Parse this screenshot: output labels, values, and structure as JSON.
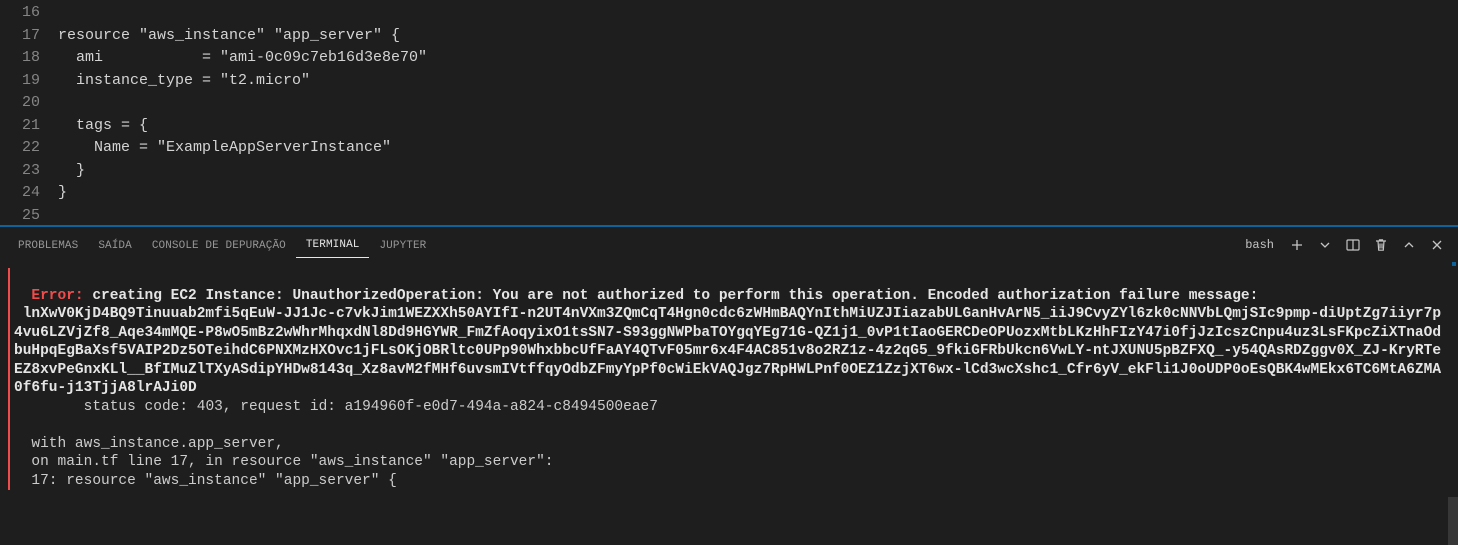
{
  "editor": {
    "first_line_number": 16,
    "lines": [
      "",
      "resource \"aws_instance\" \"app_server\" {",
      "  ami           = \"ami-0c09c7eb16d3e8e70\"",
      "  instance_type = \"t2.micro\"",
      "",
      "  tags = {",
      "    Name = \"ExampleAppServerInstance\"",
      "  }",
      "}",
      ""
    ]
  },
  "panel": {
    "tabs": {
      "problemas": "PROBLEMAS",
      "saida": "SAÍDA",
      "console": "CONSOLE DE DEPURAÇÃO",
      "terminal": "TERMINAL",
      "jupyter": "JUPYTER"
    },
    "shell_label": "bash"
  },
  "terminal": {
    "error_tag": "Error:",
    "error_first": " creating EC2 Instance: UnauthorizedOperation: You are not authorized to perform this operation. Encoded authorization failure message:",
    "encoded": " lnXwV0KjD4BQ9Tinuuab2mfi5qEuW-JJ1Jc-c7vkJim1WEZXXh50AYIfI-n2UT4nVXm3ZQmCqT4Hgn0cdc6zWHmBAQYnIthMiUZJIiazabULGanHvArN5_iiJ9CvyZYl6zk0cNNVbLQmjSIc9pmp-diUptZg7iiyr7p4vu6LZVjZf8_Aqe34mMQE-P8wO5mBz2wWhrMhqxdNl8Dd9HGYWR_FmZfAoqyixO1tsSN7-S93ggNWPbaTOYgqYEg71G-QZ1j1_0vP1tIaoGERCDeOPUozxMtbLKzHhFIzY47i0fjJzIcszCnpu4uz3LsFKpcZiXTnaOdbuHpqEgBaXsf5VAIP2Dz5OTeihdC6PNXMzHXOvc1jFLsOKjOBRltc0UPp90WhxbbcUfFaAY4QTvF05mr6x4F4AC851v8o2RZ1z-4z2qG5_9fkiGFRbUkcn6VwLY-ntJXUNU5pBZFXQ_-y54QAsRDZggv0X_ZJ-KryRTeEZ8xvPeGnxKLl__BfIMuZlTXyASdipYHDw8143q_Xz8avM2fMHf6uvsmIVtffqyOdbZFmyYpPf0cWiEkVAQJgz7RpHWLPnf0OEZ1ZzjXT6wx-lCd3wcXshc1_Cfr6yV_ekFli1J0oUDP0oEsQBK4wMEkx6TC6MtA6ZMA0f6fu-j13TjjA8lrAJi0D",
    "status": "        status code: 403, request id: a194960f-e0d7-494a-a824-c8494500eae7",
    "ctx1": "  with aws_instance.app_server,",
    "ctx2": "  on main.tf line 17, in resource \"aws_instance\" \"app_server\":",
    "ctx3": "  17: resource \"aws_instance\" \"app_server\" {"
  }
}
